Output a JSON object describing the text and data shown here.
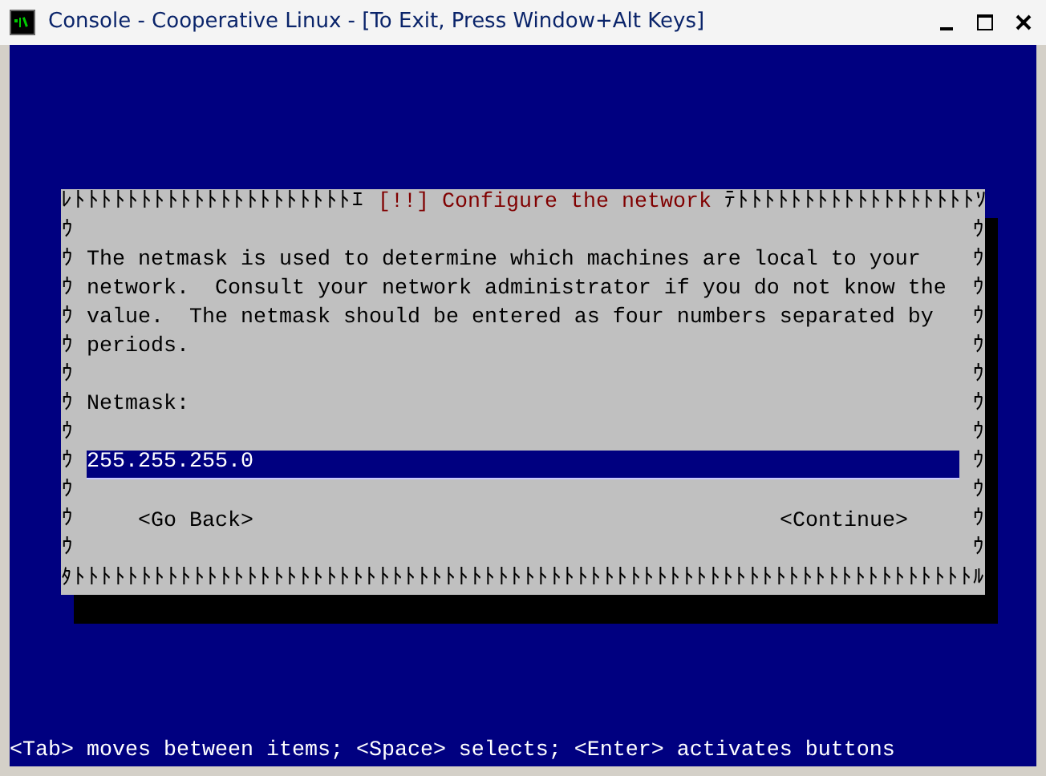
{
  "window": {
    "title": "Console - Cooperative Linux - [To Exit, Press Window+Alt Keys]"
  },
  "dialog": {
    "border_top_left": "ﾚﾄﾄﾄﾄﾄﾄﾄﾄﾄﾄﾄﾄﾄﾄﾄﾄﾄﾄﾄﾄﾄｴ",
    "title": "[!!] Configure the network",
    "border_top_right": "ﾃﾄﾄﾄﾄﾄﾄﾄﾄﾄﾄﾄﾄﾄﾄﾄﾄﾄﾄｿ",
    "border_left": "ｳｳｳｳｳｳｳｳｳｳｳｳ",
    "border_right": "ｳｳｳｳｳｳｳｳｳｳｳｳ",
    "paragraph": "The netmask is used to determine which machines are local to your\nnetwork.  Consult your network administrator if you do not know the\nvalue.  The netmask should be entered as four numbers separated by\nperiods.",
    "field_label": "Netmask:",
    "field": {
      "value": "255.255.255.0",
      "focused": true
    },
    "buttons": [
      {
        "label": "<Go Back>"
      },
      {
        "label": "<Continue>"
      }
    ],
    "border_bottom": "ﾀﾄﾄﾄﾄﾄﾄﾄﾄﾄﾄﾄﾄﾄﾄﾄﾄﾄﾄﾄﾄﾄﾄﾄﾄﾄﾄﾄﾄﾄﾄﾄﾄﾄﾄﾄﾄﾄﾄﾄﾄﾄﾄﾄﾄﾄﾄﾄﾄﾄﾄﾄﾄﾄﾄﾄﾄﾄﾄﾄﾄﾄﾄﾄﾄﾄﾄﾄﾄﾙ"
  },
  "status_line": "<Tab> moves between items; <Space> selects; <Enter> activates buttons"
}
